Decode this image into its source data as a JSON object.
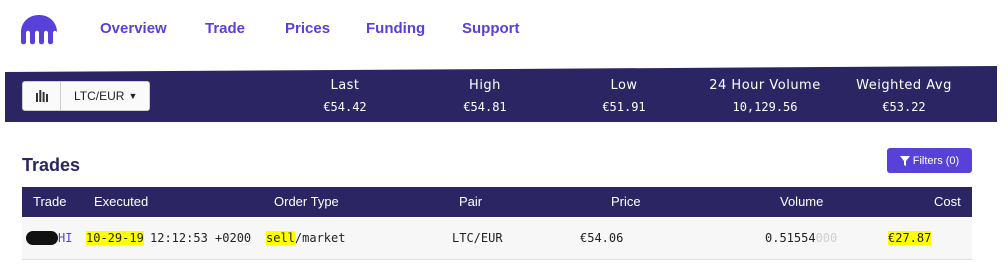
{
  "nav": {
    "links": [
      "Overview",
      "Trade",
      "Prices",
      "Funding",
      "Support"
    ]
  },
  "ticker": {
    "pair": "LTC/EUR",
    "stats": [
      {
        "label": "Last",
        "value": "€54.42"
      },
      {
        "label": "High",
        "value": "€54.81"
      },
      {
        "label": "Low",
        "value": "€51.91"
      },
      {
        "label": "24 Hour Volume",
        "value": "10,129.56"
      },
      {
        "label": "Weighted Avg",
        "value": "€53.22"
      }
    ]
  },
  "trades": {
    "title": "Trades",
    "filters_label": "Filters (0)",
    "columns": [
      "Trade",
      "Executed",
      "Order Type",
      "Pair",
      "Price",
      "Volume",
      "Cost"
    ],
    "rows": [
      {
        "trade_suffix": "HI",
        "executed_date": "10-29-19",
        "executed_time": "12:12:53 +0200",
        "side": "sell",
        "order_type_rest": "/market",
        "pair": "LTC/EUR",
        "price": "€54.06",
        "volume_main": "0.51554",
        "volume_trailing": "000",
        "cost": "€27.87"
      }
    ]
  },
  "colors": {
    "brand": "#5741d9",
    "dark_band": "#2b2663",
    "highlight": "#ffff00"
  }
}
